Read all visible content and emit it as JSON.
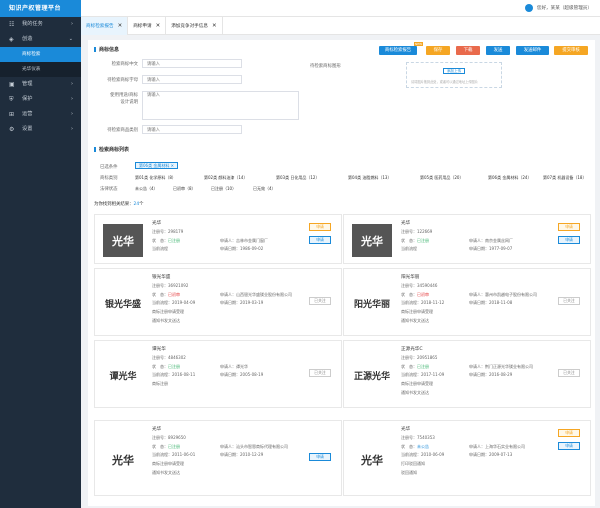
{
  "app_title": "知识产权管理平台",
  "sidebar": {
    "items": [
      {
        "label": "我的任务",
        "icon": "task-icon"
      },
      {
        "label": "创造",
        "icon": "create-icon"
      },
      {
        "label": "管理",
        "icon": "manage-icon"
      },
      {
        "label": "保护",
        "icon": "protect-icon"
      },
      {
        "label": "运营",
        "icon": "operate-icon"
      },
      {
        "label": "设置",
        "icon": "settings-icon"
      }
    ],
    "sub_items": [
      {
        "label": "商标检索"
      },
      {
        "label": "光华仪表"
      }
    ]
  },
  "topbar": {
    "user_text": "您好，某某（超级管理员）"
  },
  "tabs": [
    {
      "label": "商标检索报告"
    },
    {
      "label": "商标申请"
    },
    {
      "label": "添加竞争对手信息"
    }
  ],
  "section1": {
    "title": "商标信息"
  },
  "buttons": [
    {
      "label": "商标检索报告",
      "color": "#1a8ad9"
    },
    {
      "label": "保存",
      "color": "#f5a623"
    },
    {
      "label": "下载",
      "color": "#e96a4c"
    },
    {
      "label": "发送",
      "color": "#1a8ad9"
    },
    {
      "label": "发送邮件",
      "color": "#1a8ad9"
    },
    {
      "label": "提交审核",
      "color": "#f5a623"
    }
  ],
  "badge": "NEW",
  "form": {
    "cn_label": "检索商标中文",
    "cn_placeholder": "请输入",
    "pinyin_label": "待检索商标字母",
    "pinyin_placeholder": "请输入",
    "use_label": "使用用途/商标",
    "use_label2": "设计说明",
    "use_placeholder": "请输入",
    "class_label": "待检索商品类别",
    "class_placeholder": "请输入",
    "img_label": "待检索商标图形",
    "upload_btn": "添加上传",
    "upload_hint": "请将图片拖到此处，或者可以通过地址上传图片"
  },
  "section2": {
    "title": "检索商标列表"
  },
  "filters": {
    "selected_label": "已选条件",
    "selected_chip": "第06类 金属材料 ✕",
    "class_label": "商标类别",
    "classes": [
      "第01类 化学原料（8）",
      "第02类 颜料油漆（14）",
      "第03类 日化用品（12）",
      "第04类 油脂燃料（13）",
      "第05类 医药用品（20）",
      "第06类 金属材料（24）",
      "第07类 机器设备（18）"
    ],
    "status_label": "法律状态",
    "statuses": [
      "未公告（4）",
      "已初审（8）",
      "已注册（10）",
      "已无效（4）"
    ]
  },
  "result": {
    "prefix": "为你找到相关结果：",
    "count": "24",
    "suffix": "个"
  },
  "card_labels": {
    "reg": "注册号：",
    "status": "状　态：",
    "applicant": "申请人：",
    "apply_date": "申请日期：",
    "current_status": "当前流程："
  },
  "cards": [
    {
      "name": "光华",
      "reg": "298179",
      "status": "已注册",
      "status_color": "grn",
      "applicant": "吉林市金属门窗厂",
      "apply_date": "1986-09-02",
      "current": "",
      "extra1": "当前流程",
      "extra2": "",
      "badges": [
        "申请",
        "申请"
      ],
      "badge_styles": [
        "orange",
        "blue"
      ],
      "logo": "光华"
    },
    {
      "name": "光华",
      "reg": "122669",
      "status": "已注册",
      "status_color": "grn",
      "applicant": "南京金属丝网厂",
      "apply_date": "1977-09-07",
      "current": "",
      "extra1": "当前流程",
      "extra2": "",
      "badges": [
        "申请",
        "申请"
      ],
      "badge_styles": [
        "orange",
        "blue"
      ],
      "logo": "光华"
    },
    {
      "name": "银光华盛",
      "reg": "36921092",
      "status": "已初审",
      "status_color": "red",
      "applicant": "山西银光华盛镁业股份有限公司",
      "apply_date": "2019-03-19",
      "current": "2019-04-09",
      "extra1": "商标注册申请受理",
      "extra2": "通知书发文送达",
      "badges": [
        "已关注"
      ],
      "badge_styles": [
        "gray"
      ],
      "logo": "银光华盛"
    },
    {
      "name": "阳光华丽",
      "reg": "34590446",
      "status": "已初审",
      "status_color": "red",
      "applicant": "惠州市凯越电子股份有限公司",
      "apply_date": "2018-11-08",
      "current": "2018-11-12",
      "extra1": "商标注册申请受理",
      "extra2": "通知书发文送达",
      "badges": [
        "已关注"
      ],
      "badge_styles": [
        "gray"
      ],
      "logo": "阳光华丽"
    },
    {
      "name": "谭光华",
      "reg": "4846302",
      "status": "已注册",
      "status_color": "grn",
      "applicant": "谭光华",
      "apply_date": "2005-08-19",
      "current": "2016-08-11",
      "extra1": "商标注册",
      "extra2": "",
      "badges": [
        "已关注"
      ],
      "badge_styles": [
        "gray"
      ],
      "logo": "谭光华"
    },
    {
      "name": "正源光华C",
      "reg": "20951865",
      "status": "已注册",
      "status_color": "grn",
      "applicant": "荆门正源光华镁业有限公司",
      "apply_date": "2016-08-29",
      "current": "2017-11-09",
      "extra1": "商标注册申请受理",
      "extra2": "通知书发文送达",
      "badges": [
        "已关注"
      ],
      "badge_styles": [
        "gray"
      ],
      "logo": "正源光华"
    },
    {
      "name": "光华",
      "reg": "8929650",
      "status": "已注册",
      "status_color": "grn",
      "applicant": "汕头市智恩商标代理有限公司",
      "apply_date": "2010-12-29",
      "current": "2011-06-01",
      "extra1": "商标注册申请受理",
      "extra2": "通知书发文送达",
      "badges": [
        "申请"
      ],
      "badge_styles": [
        "blue"
      ],
      "logo": "光华"
    },
    {
      "name": "光华",
      "reg": "7540353",
      "status": "未公告",
      "status_color": "blu",
      "applicant": "上海华石实业有限公司",
      "apply_date": "2009-07-13",
      "current": "2010-06-09",
      "extra1": "打印驳回通知",
      "extra2": "驳回通知",
      "badges": [
        "申请",
        "申请"
      ],
      "badge_styles": [
        "orange",
        "blue"
      ],
      "logo": "光华"
    }
  ]
}
